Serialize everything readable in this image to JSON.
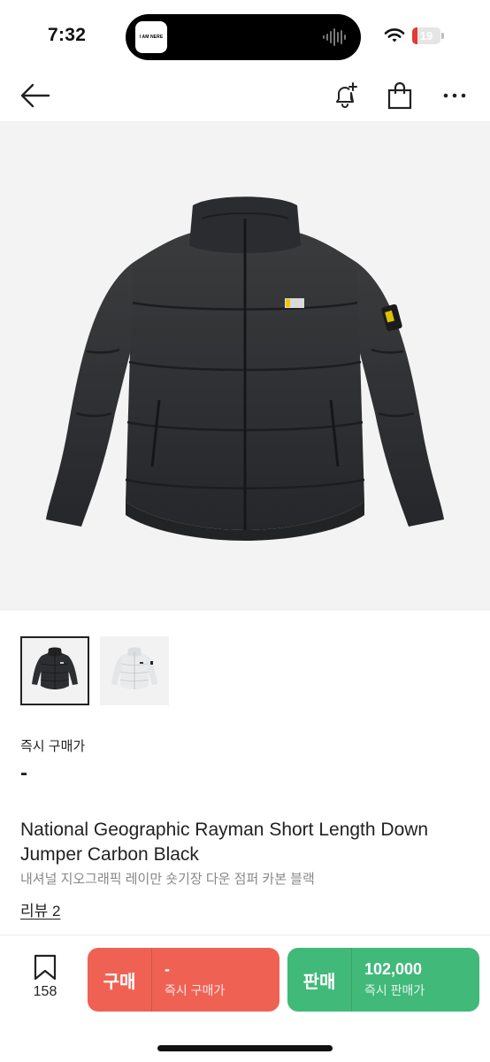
{
  "status_bar": {
    "time": "7:32",
    "battery": "19",
    "battery_level": 0.19,
    "island_app_text": "I AM NERE"
  },
  "nav": {
    "icons": [
      "back-arrow-icon",
      "bell-plus-icon",
      "shopping-bag-icon",
      "more-icon"
    ]
  },
  "product": {
    "thumbnails": [
      "black-jumper",
      "white-jumper"
    ],
    "instant_price_label": "즉시 구매가",
    "instant_price_value": "-",
    "title_en": "National Geographic Rayman Short Length Down Jumper Carbon Black",
    "title_ko": "내셔널 지오그래픽 레이만 숏기장 다운 점퍼 카본 블랙",
    "review_link": "리뷰 2"
  },
  "bottom_bar": {
    "wish_count": "158",
    "buy": {
      "label": "구매",
      "price": "-",
      "sub": "즉시 구매가",
      "color": "#ef6253"
    },
    "sell": {
      "label": "판매",
      "price": "102,000",
      "sub": "즉시 판매가",
      "color": "#41b979"
    }
  }
}
